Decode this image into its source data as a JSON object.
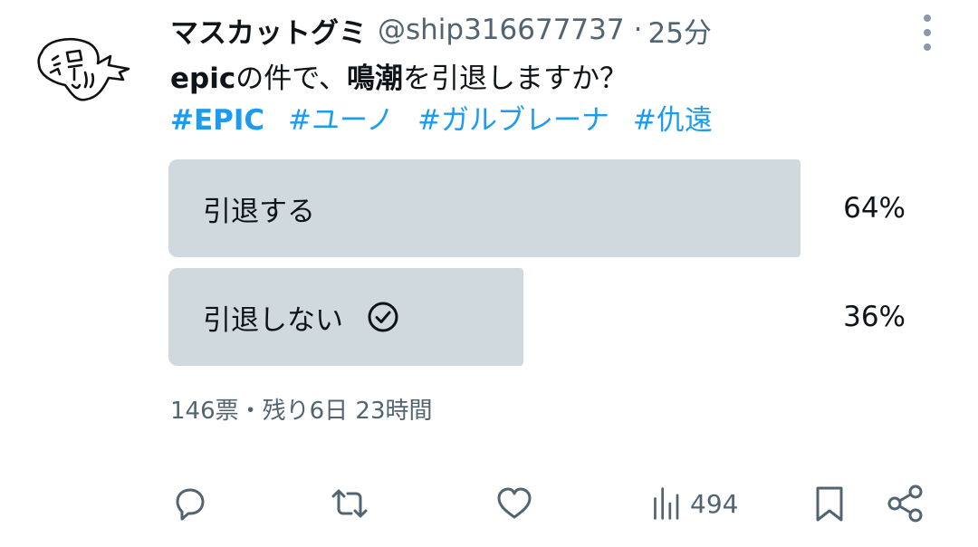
{
  "user": {
    "display_name": "マスカットグミ",
    "handle": "@ship316677737",
    "separator": "·",
    "time": "25分"
  },
  "tweet": {
    "text_part1": "epic",
    "text_part2": "の件で、",
    "text_part3": "鳴潮",
    "text_part4": "を引退しますか？",
    "hashtags": [
      "#EPIC",
      "#ユーノ",
      "#ガルブレーナ",
      "#仇遠"
    ]
  },
  "poll": {
    "options": [
      {
        "label": "引退する",
        "percent_text": "64%",
        "share": 0.64,
        "selected": false
      },
      {
        "label": "引退しない",
        "percent_text": "36%",
        "share": 0.36,
        "selected": true
      }
    ],
    "meta": "146票・残り6日 23時間"
  },
  "actions": {
    "views": "494"
  },
  "icons": {
    "more": "more-vertical-icon",
    "reply": "reply-icon",
    "retweet": "retweet-icon",
    "like": "heart-icon",
    "views": "views-chart-icon",
    "bookmark": "bookmark-icon",
    "share": "share-icon",
    "check": "check-circle-icon"
  },
  "colors": {
    "link": "#1d9bf0",
    "muted": "#536471",
    "poll_bar": "#cfd9de"
  }
}
